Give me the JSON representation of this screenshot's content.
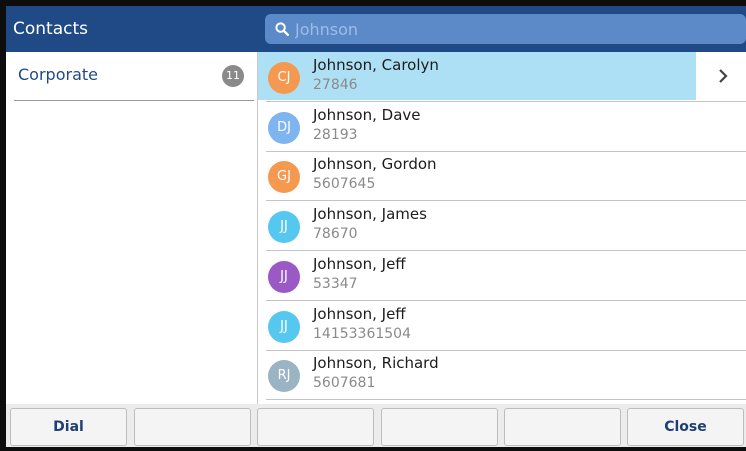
{
  "header": {
    "title": "Contacts",
    "search": {
      "placeholder": "Johnson",
      "value": ""
    }
  },
  "sidebar": {
    "groups": [
      {
        "label": "Corporate",
        "count": "11"
      }
    ]
  },
  "contacts": [
    {
      "name": "Johnson, Carolyn",
      "number": "27846",
      "initials": "CJ",
      "avatar_color": "#f59850",
      "selected": true
    },
    {
      "name": "Johnson, Dave",
      "number": "28193",
      "initials": "DJ",
      "avatar_color": "#7eb4ef",
      "selected": false
    },
    {
      "name": "Johnson, Gordon",
      "number": "5607645",
      "initials": "GJ",
      "avatar_color": "#f59850",
      "selected": false
    },
    {
      "name": "Johnson, James",
      "number": "78670",
      "initials": "JJ",
      "avatar_color": "#56c8f0",
      "selected": false
    },
    {
      "name": "Johnson, Jeff",
      "number": "53347",
      "initials": "JJ",
      "avatar_color": "#9b59c6",
      "selected": false
    },
    {
      "name": "Johnson, Jeff",
      "number": "14153361504",
      "initials": "JJ",
      "avatar_color": "#56c8f0",
      "selected": false
    },
    {
      "name": "Johnson, Richard",
      "number": "5607681",
      "initials": "RJ",
      "avatar_color": "#9bb4c4",
      "selected": false
    }
  ],
  "softkeys": [
    {
      "label": "Dial"
    },
    {
      "label": ""
    },
    {
      "label": ""
    },
    {
      "label": ""
    },
    {
      "label": ""
    },
    {
      "label": "Close"
    }
  ],
  "colors": {
    "header_bg": "#1f4a86",
    "search_bg": "#5c8ac9",
    "selected_row_bg": "#aee0f5"
  },
  "icons": {
    "search": "search-icon",
    "row_action": "chevron-right-icon"
  }
}
